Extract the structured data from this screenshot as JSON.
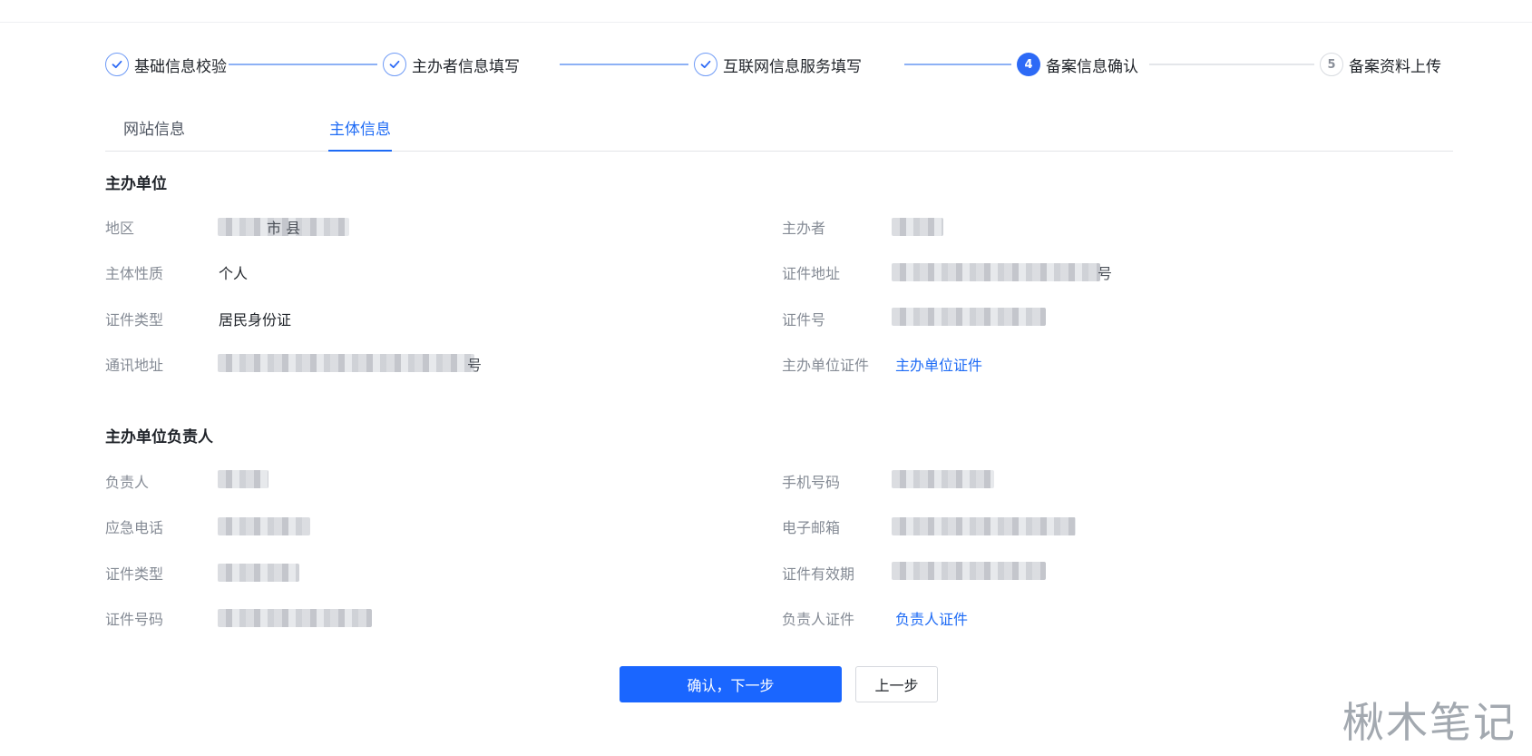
{
  "steps": [
    {
      "index": "1",
      "label": "基础信息校验",
      "state": "done"
    },
    {
      "index": "2",
      "label": "主办者信息填写",
      "state": "done"
    },
    {
      "index": "3",
      "label": "互联网信息服务填写",
      "state": "done"
    },
    {
      "index": "4",
      "label": "备案信息确认",
      "state": "active"
    },
    {
      "index": "5",
      "label": "备案资料上传",
      "state": "todo"
    }
  ],
  "tabs": {
    "website": "网站信息",
    "subject": "主体信息",
    "active": "subject"
  },
  "sponsor_unit": {
    "title": "主办单位",
    "region_label": "地区",
    "region_value_suffix": "市 县",
    "sponsor_label": "主办者",
    "nature_label": "主体性质",
    "nature_value": "个人",
    "cert_address_label": "证件地址",
    "cert_address_suffix": "号",
    "cert_type_label": "证件类型",
    "cert_type_value": "居民身份证",
    "cert_no_label": "证件号",
    "mail_address_label": "通讯地址",
    "mail_address_suffix": "号",
    "unit_cert_label": "主办单位证件",
    "unit_cert_link": "主办单位证件"
  },
  "leader": {
    "title": "主办单位负责人",
    "name_label": "负责人",
    "phone_label": "手机号码",
    "emergency_label": "应急电话",
    "email_label": "电子邮箱",
    "cert_type_label": "证件类型",
    "cert_valid_label": "证件有效期",
    "cert_no_label": "证件号码",
    "leader_cert_label": "负责人证件",
    "leader_cert_link": "负责人证件"
  },
  "actions": {
    "confirm": "确认，下一步",
    "prev": "上一步"
  },
  "watermark": "楸木笔记",
  "colors": {
    "primary": "#1a66ff",
    "link": "#1e6bf5",
    "step_done_line": "#8db1f5",
    "label_gray": "#858b95"
  }
}
